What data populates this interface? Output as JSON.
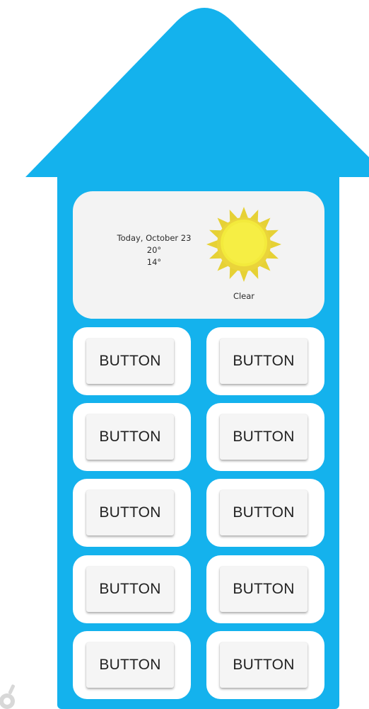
{
  "colors": {
    "house_blue": "#14b2ed",
    "card_bg": "#f3f3f3",
    "cell_bg": "#ffffff",
    "button_bg": "#f5f5f5",
    "sun_yellow": "#f2e63a",
    "sun_ray": "#e8d23a"
  },
  "weather": {
    "date": "Today, October 23",
    "high": "20°",
    "low": "14°",
    "condition": "Clear",
    "icon": "sun-icon"
  },
  "buttons": [
    {
      "label": "BUTTON"
    },
    {
      "label": "BUTTON"
    },
    {
      "label": "BUTTON"
    },
    {
      "label": "BUTTON"
    },
    {
      "label": "BUTTON"
    },
    {
      "label": "BUTTON"
    },
    {
      "label": "BUTTON"
    },
    {
      "label": "BUTTON"
    },
    {
      "label": "BUTTON"
    },
    {
      "label": "BUTTON"
    }
  ]
}
